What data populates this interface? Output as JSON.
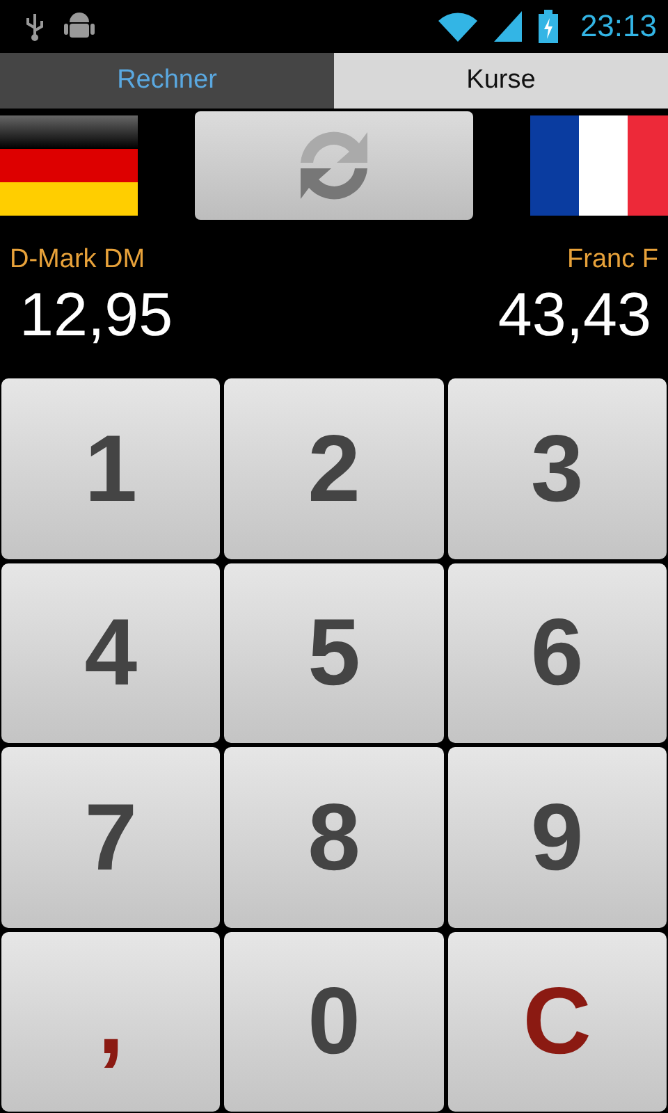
{
  "status_bar": {
    "time": "23:13"
  },
  "tabs": [
    {
      "label": "Rechner",
      "selected": true
    },
    {
      "label": "Kurse",
      "selected": false
    }
  ],
  "converter": {
    "from": {
      "currency": "D-Mark DM",
      "value": "12,95"
    },
    "to": {
      "currency": "Franc F",
      "value": "43,43"
    }
  },
  "keypad": [
    {
      "label": "1",
      "kind": "digit"
    },
    {
      "label": "2",
      "kind": "digit"
    },
    {
      "label": "3",
      "kind": "digit"
    },
    {
      "label": "4",
      "kind": "digit"
    },
    {
      "label": "5",
      "kind": "digit"
    },
    {
      "label": "6",
      "kind": "digit"
    },
    {
      "label": "7",
      "kind": "digit"
    },
    {
      "label": "8",
      "kind": "digit"
    },
    {
      "label": "9",
      "kind": "digit"
    },
    {
      "label": ",",
      "kind": "action"
    },
    {
      "label": "0",
      "kind": "digit"
    },
    {
      "label": "C",
      "kind": "action"
    }
  ]
}
